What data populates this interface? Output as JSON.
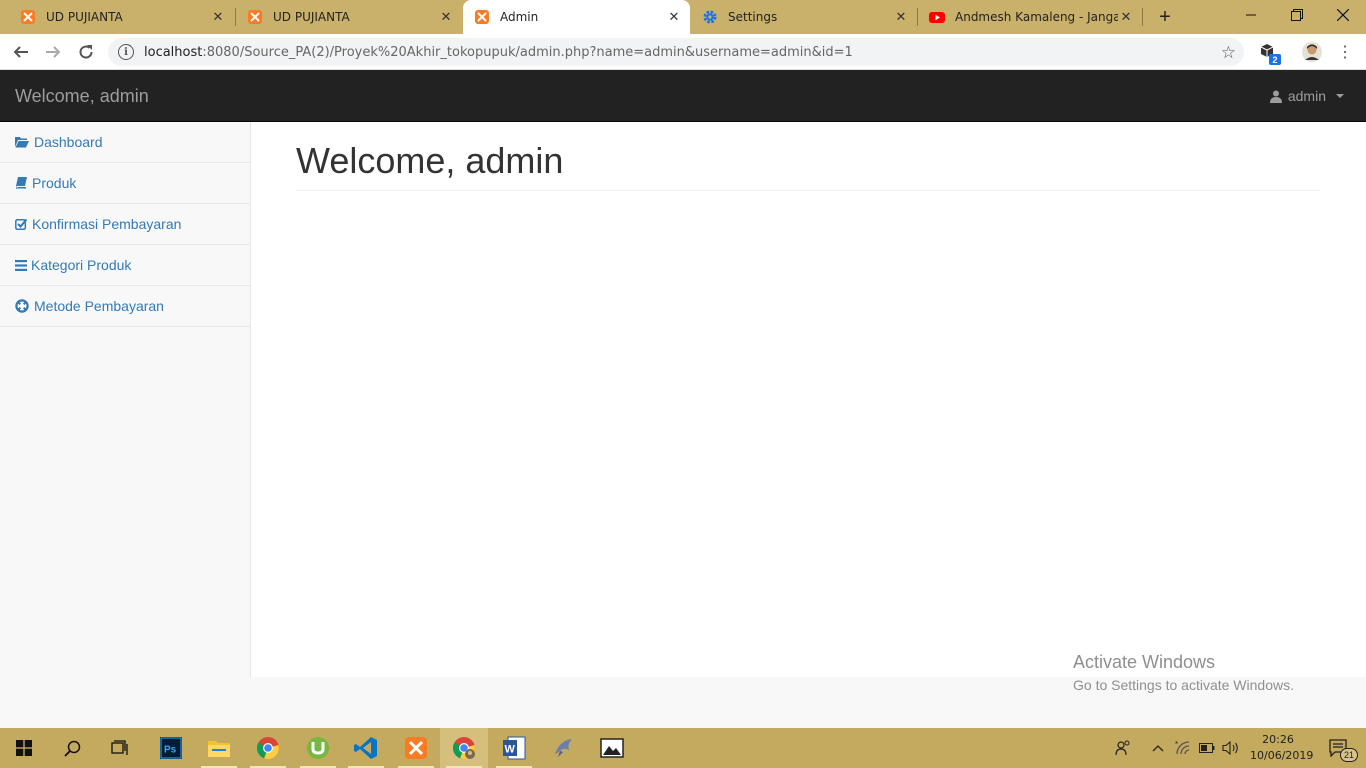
{
  "browser": {
    "tabs": [
      {
        "title": "UD PUJIANTA",
        "icon": "xampp-icon",
        "active": false
      },
      {
        "title": "UD PUJIANTA",
        "icon": "xampp-icon",
        "active": false
      },
      {
        "title": "Admin",
        "icon": "xampp-icon",
        "active": true
      },
      {
        "title": "Settings",
        "icon": "gear-icon",
        "active": false
      },
      {
        "title": "Andmesh Kamaleng - Jangan R",
        "icon": "youtube-icon",
        "active": false
      }
    ],
    "url_host": "localhost",
    "url_rest": ":8080/Source_PA(2)/Proyek%20Akhir_tokopupuk/admin.php?name=admin&username=admin&id=1",
    "extension_badge": "2"
  },
  "navbar": {
    "brand": "Welcome, admin",
    "user_label": "admin"
  },
  "sidebar": {
    "items": [
      {
        "label": "Dashboard",
        "icon": "folder-open-icon"
      },
      {
        "label": "Produk",
        "icon": "book-icon"
      },
      {
        "label": "Konfirmasi Pembayaran",
        "icon": "check-square-icon"
      },
      {
        "label": "Kategori Produk",
        "icon": "bars-icon"
      },
      {
        "label": "Metode Pembayaran",
        "icon": "life-ring-icon"
      }
    ]
  },
  "main": {
    "heading": "Welcome, admin"
  },
  "watermark": {
    "line1": "Activate Windows",
    "line2": "Go to Settings to activate Windows."
  },
  "taskbar": {
    "apps": [
      "windows-start-icon",
      "search-icon",
      "task-view-icon",
      "photoshop-icon",
      "file-explorer-icon",
      "chrome-icon",
      "utorrent-icon",
      "vscode-icon",
      "xampp-icon",
      "chrome-profile-icon",
      "word-icon",
      "dolphin-icon",
      "photos-icon"
    ],
    "time": "20:26",
    "date": "10/06/2019",
    "notification_count": "21"
  },
  "colors": {
    "tabstrip": "#c9b06b",
    "navbar": "#222222",
    "link": "#337ab7",
    "taskbar": "#c4aa5e"
  }
}
